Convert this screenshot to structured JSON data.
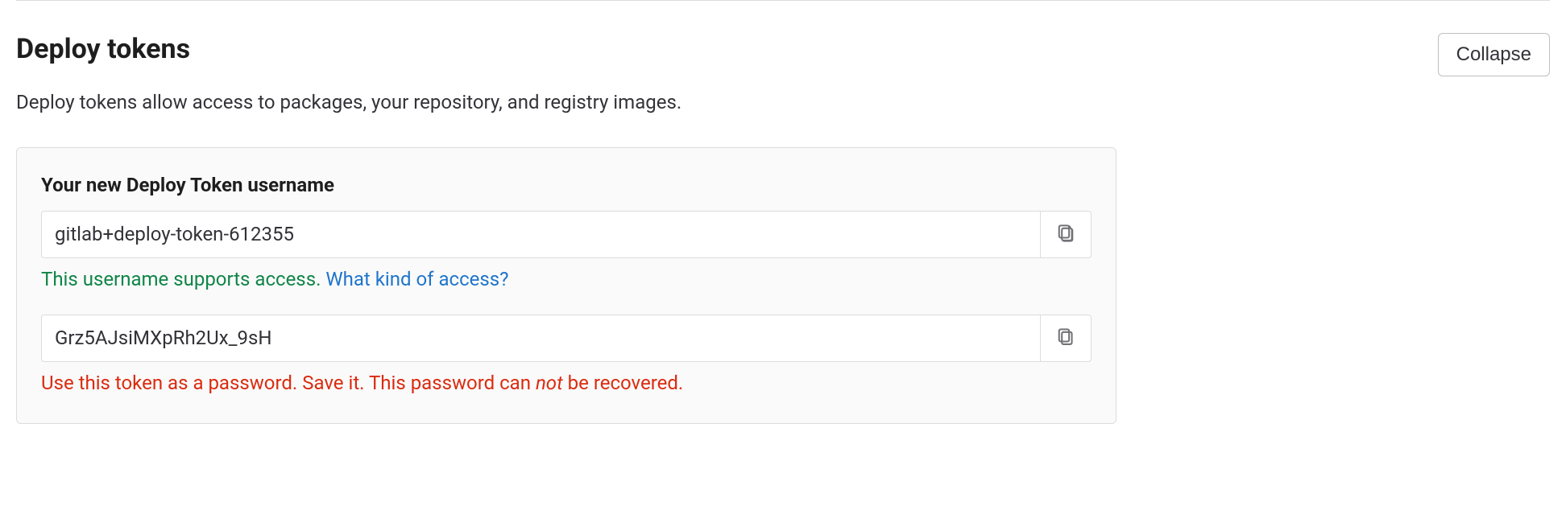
{
  "section": {
    "title": "Deploy tokens",
    "description": "Deploy tokens allow access to packages, your repository, and registry images.",
    "collapse_label": "Collapse"
  },
  "card": {
    "label": "Your new Deploy Token username",
    "username_value": "gitlab+deploy-token-612355",
    "username_helper": "This username supports access.",
    "username_link": "What kind of access?",
    "token_value": "Grz5AJsiMXpRh2Ux_9sH",
    "token_helper_pre": "Use this token as a password. Save it. This password can ",
    "token_helper_em": "not",
    "token_helper_post": " be recovered."
  }
}
